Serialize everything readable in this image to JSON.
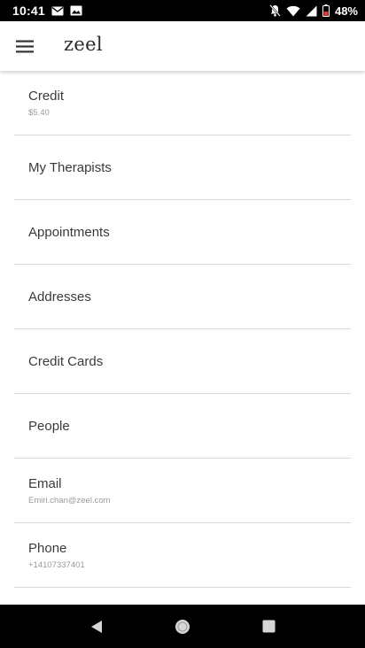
{
  "status_bar": {
    "time": "10:41",
    "battery": "48%",
    "icons": [
      "mail-icon",
      "image-icon",
      "notifications-off-icon",
      "wifi-icon",
      "signal-icon",
      "battery-icon"
    ]
  },
  "app_bar": {
    "logo": "zeel",
    "menu_icon": "hamburger-menu-icon"
  },
  "menu": {
    "items": [
      {
        "label": "Credit",
        "sub": "$5.40"
      },
      {
        "label": "My Therapists",
        "sub": ""
      },
      {
        "label": "Appointments",
        "sub": ""
      },
      {
        "label": "Addresses",
        "sub": ""
      },
      {
        "label": "Credit Cards",
        "sub": ""
      },
      {
        "label": "People",
        "sub": ""
      },
      {
        "label": "Email",
        "sub": "Emiri.chan@zeel.com"
      },
      {
        "label": "Phone",
        "sub": "+14107337401"
      }
    ]
  },
  "nav_bar": {
    "icons": [
      "back-icon",
      "home-icon",
      "recents-icon"
    ]
  },
  "colors": {
    "status_bar_bg": "#000000",
    "app_bar_bg": "#ffffff",
    "text_primary": "#3a3a3a",
    "text_secondary": "#9a9a9a",
    "divider": "#d9d9d9",
    "battery_low": "#e53935"
  }
}
